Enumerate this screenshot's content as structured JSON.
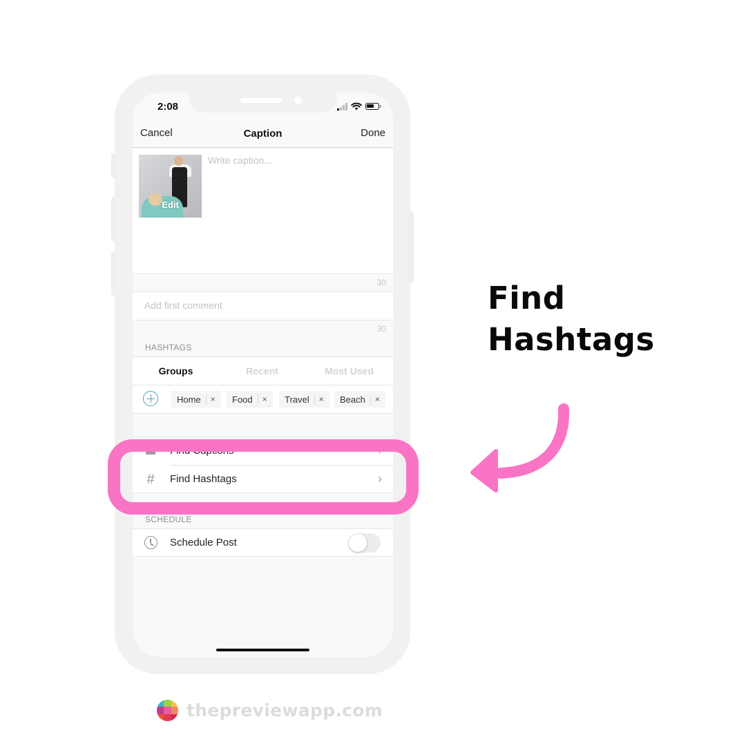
{
  "status_bar": {
    "time": "2:08",
    "icons": [
      "signal-icon",
      "wifi-icon",
      "battery-icon"
    ]
  },
  "navbar": {
    "cancel_label": "Cancel",
    "title": "Caption",
    "done_label": "Done"
  },
  "caption": {
    "thumbnail_overlay_label": "Edit",
    "placeholder": "Write caption...",
    "value": "",
    "remaining_count": "30"
  },
  "first_comment": {
    "placeholder": "Add first comment",
    "value": "",
    "remaining_count": "30"
  },
  "hashtags": {
    "section_label": "HASHTAGS",
    "tabs": [
      {
        "label": "Groups",
        "active": true
      },
      {
        "label": "Recent",
        "active": false
      },
      {
        "label": "Most Used",
        "active": false
      }
    ],
    "add_icon": "plus-circle-icon",
    "groups": [
      {
        "label": "Home"
      },
      {
        "label": "Food"
      },
      {
        "label": "Travel"
      },
      {
        "label": "Beach"
      }
    ],
    "remove_glyph": "×"
  },
  "tools": {
    "items": [
      {
        "label": "Find Captions",
        "icon": "caption-lines-icon",
        "chevron": "›"
      },
      {
        "label": "Find Hashtags",
        "icon": "hash-icon",
        "icon_glyph": "#",
        "chevron": "›"
      }
    ]
  },
  "schedule": {
    "section_label": "SCHEDULE",
    "label": "Schedule Post",
    "enabled": false
  },
  "annotation": {
    "callout_line1": "Find",
    "callout_line2": "Hashtags",
    "highlight_color": "#f974c5",
    "arrow_color": "#f974c5"
  },
  "footer": {
    "brand_text": "thepreviewapp.com",
    "logo_colors": [
      "#3fb6c6",
      "#9ad24a",
      "#f3c34a",
      "#c23a93",
      "#ef5b9c",
      "#f28b5c",
      "#e8532f",
      "#e13a4f",
      "#d32a55"
    ]
  }
}
